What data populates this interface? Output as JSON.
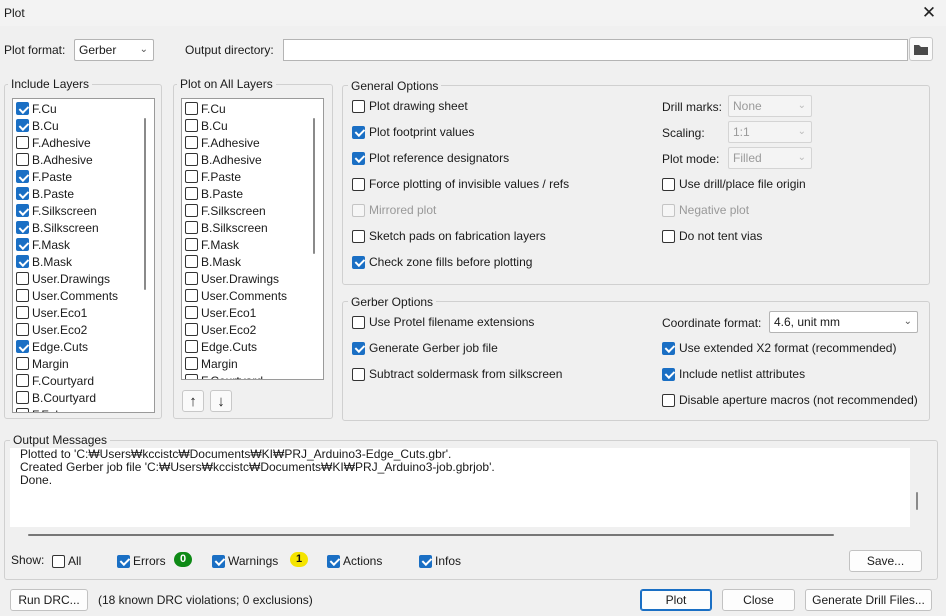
{
  "window": {
    "title": "Plot"
  },
  "top": {
    "plot_format_label": "Plot format:",
    "plot_format_value": "Gerber",
    "output_dir_label": "Output directory:",
    "output_dir_value": ""
  },
  "include_layers": {
    "title": "Include Layers",
    "items": [
      {
        "label": "F.Cu",
        "checked": true
      },
      {
        "label": "B.Cu",
        "checked": true
      },
      {
        "label": "F.Adhesive",
        "checked": false
      },
      {
        "label": "B.Adhesive",
        "checked": false
      },
      {
        "label": "F.Paste",
        "checked": true
      },
      {
        "label": "B.Paste",
        "checked": true
      },
      {
        "label": "F.Silkscreen",
        "checked": true
      },
      {
        "label": "B.Silkscreen",
        "checked": true
      },
      {
        "label": "F.Mask",
        "checked": true
      },
      {
        "label": "B.Mask",
        "checked": true
      },
      {
        "label": "User.Drawings",
        "checked": false
      },
      {
        "label": "User.Comments",
        "checked": false
      },
      {
        "label": "User.Eco1",
        "checked": false
      },
      {
        "label": "User.Eco2",
        "checked": false
      },
      {
        "label": "Edge.Cuts",
        "checked": true
      },
      {
        "label": "Margin",
        "checked": false
      },
      {
        "label": "F.Courtyard",
        "checked": false
      },
      {
        "label": "B.Courtyard",
        "checked": false
      },
      {
        "label": "F.Fab",
        "checked": false
      }
    ]
  },
  "plot_all_layers": {
    "title": "Plot on All Layers",
    "items": [
      {
        "label": "F.Cu",
        "checked": false
      },
      {
        "label": "B.Cu",
        "checked": false
      },
      {
        "label": "F.Adhesive",
        "checked": false
      },
      {
        "label": "B.Adhesive",
        "checked": false
      },
      {
        "label": "F.Paste",
        "checked": false
      },
      {
        "label": "B.Paste",
        "checked": false
      },
      {
        "label": "F.Silkscreen",
        "checked": false
      },
      {
        "label": "B.Silkscreen",
        "checked": false
      },
      {
        "label": "F.Mask",
        "checked": false
      },
      {
        "label": "B.Mask",
        "checked": false
      },
      {
        "label": "User.Drawings",
        "checked": false
      },
      {
        "label": "User.Comments",
        "checked": false
      },
      {
        "label": "User.Eco1",
        "checked": false
      },
      {
        "label": "User.Eco2",
        "checked": false
      },
      {
        "label": "Edge.Cuts",
        "checked": false
      },
      {
        "label": "Margin",
        "checked": false
      },
      {
        "label": "F.Courtyard",
        "checked": false
      }
    ]
  },
  "general_options": {
    "title": "General Options",
    "left": [
      {
        "label": "Plot drawing sheet",
        "checked": false,
        "disabled": false
      },
      {
        "label": "Plot footprint values",
        "checked": true,
        "disabled": false
      },
      {
        "label": "Plot reference designators",
        "checked": true,
        "disabled": false
      },
      {
        "label": "Force plotting of invisible values / refs",
        "checked": false,
        "disabled": false
      },
      {
        "label": "Mirrored plot",
        "checked": false,
        "disabled": true
      },
      {
        "label": "Sketch pads on fabrication layers",
        "checked": false,
        "disabled": false
      },
      {
        "label": "Check zone fills before plotting",
        "checked": true,
        "disabled": false
      }
    ],
    "drill_marks_label": "Drill marks:",
    "drill_marks_value": "None",
    "scaling_label": "Scaling:",
    "scaling_value": "1:1",
    "plot_mode_label": "Plot mode:",
    "plot_mode_value": "Filled",
    "right": [
      {
        "label": "Use drill/place file origin",
        "checked": false,
        "disabled": false
      },
      {
        "label": "Negative plot",
        "checked": false,
        "disabled": true
      },
      {
        "label": "Do not tent vias",
        "checked": false,
        "disabled": false
      }
    ]
  },
  "gerber_options": {
    "title": "Gerber Options",
    "left": [
      {
        "label": "Use Protel filename extensions",
        "checked": false
      },
      {
        "label": "Generate Gerber job file",
        "checked": true
      },
      {
        "label": "Subtract soldermask from silkscreen",
        "checked": false
      }
    ],
    "coord_format_label": "Coordinate format:",
    "coord_format_value": "4.6, unit mm",
    "right": [
      {
        "label": "Use extended X2 format (recommended)",
        "checked": true
      },
      {
        "label": "Include netlist attributes",
        "checked": true
      },
      {
        "label": "Disable aperture macros (not recommended)",
        "checked": false
      }
    ]
  },
  "output_messages": {
    "title": "Output Messages",
    "lines": [
      "Plotted to 'C:₩Users₩kccistc₩Documents₩KI₩PRJ_Arduino3-Edge_Cuts.gbr'.",
      "Created Gerber job file 'C:₩Users₩kccistc₩Documents₩KI₩PRJ_Arduino3-job.gbrjob'.",
      "Done."
    ]
  },
  "show_filter": {
    "label": "Show:",
    "all_label": "All",
    "all_checked": false,
    "errors_label": "Errors",
    "errors_checked": true,
    "errors_count": "0",
    "warnings_label": "Warnings",
    "warnings_checked": true,
    "warnings_count": "1",
    "actions_label": "Actions",
    "actions_checked": true,
    "infos_label": "Infos",
    "infos_checked": true,
    "save_label": "Save..."
  },
  "bottom": {
    "run_drc_label": "Run DRC...",
    "drc_status": "(18 known DRC violations; 0 exclusions)",
    "plot_label": "Plot",
    "close_label": "Close",
    "generate_drill_label": "Generate Drill Files..."
  },
  "colors": {
    "accent": "#1a6fc4",
    "errors_badge": "#0e8a16",
    "warnings_badge": "#f5e400"
  }
}
